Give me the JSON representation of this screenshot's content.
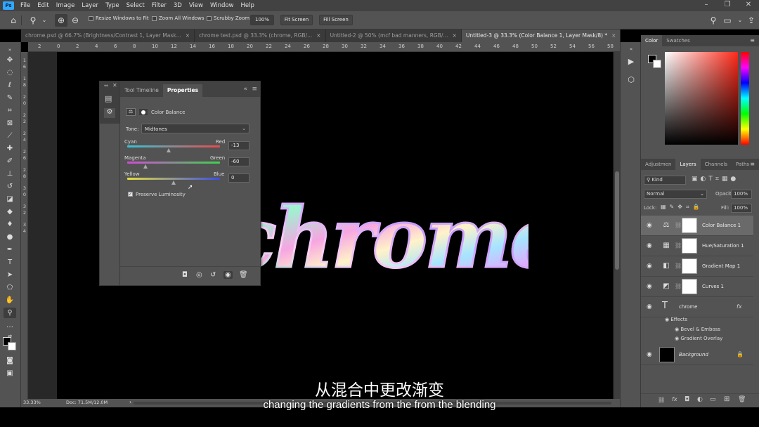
{
  "app": {
    "logo": "Ps"
  },
  "menu": [
    "File",
    "Edit",
    "Image",
    "Layer",
    "Type",
    "Select",
    "Filter",
    "3D",
    "View",
    "Window",
    "Help"
  ],
  "options": {
    "resize_windows": "Resize Windows to Fit",
    "zoom_all": "Zoom All Windows",
    "scrubby_zoom": "Scrubby Zoom",
    "zoom_value": "100%",
    "fit_screen": "Fit Screen",
    "fill_screen": "Fill Screen"
  },
  "tabs": [
    {
      "label": "chrome.psd @ 66.7% (Brightness/Contrast 1, Layer Mask...",
      "close": "×"
    },
    {
      "label": "chrome test.psd @ 33.3% (chrome, RGB/...",
      "close": "×"
    },
    {
      "label": "Untitled-2 @ 50% (mcf bad manners, RGB/...",
      "close": "×"
    },
    {
      "label": "Untitled-3 @ 33.3% (Color Balance 1, Layer Mask/8) *",
      "close": "×"
    }
  ],
  "ruler_top": [
    "2",
    "0",
    "2",
    "4",
    "6",
    "8",
    "10",
    "12",
    "14",
    "16",
    "18",
    "20",
    "22",
    "24",
    "26",
    "28",
    "30",
    "32",
    "34",
    "36",
    "38",
    "40",
    "42",
    "44",
    "46",
    "48",
    "50",
    "52",
    "54",
    "56",
    "58"
  ],
  "ruler_left": [
    "1",
    "6",
    "1",
    "8",
    "2",
    "0",
    "2",
    "2",
    "2",
    "4",
    "2",
    "6",
    "2",
    "8",
    "3",
    "0",
    "3",
    "2",
    "3",
    "4"
  ],
  "canvas_text": "chrome",
  "properties": {
    "tab_timeline": "Tool Timeline",
    "tab_properties": "Properties",
    "collapse": "«",
    "menu": "≡",
    "title": "Color Balance",
    "tone_label": "Tone:",
    "tone_value": "Midtones",
    "sliders": [
      {
        "left": "Cyan",
        "right": "Red",
        "value": "-13",
        "pos": 0.45
      },
      {
        "left": "Magenta",
        "right": "Green",
        "value": "-60",
        "pos": 0.2
      },
      {
        "left": "Yellow",
        "right": "Blue",
        "value": "0",
        "pos": 0.5
      }
    ],
    "preserve": "Preserve Luminosity"
  },
  "status": {
    "zoom": "33.33%",
    "doc": "Doc: 71.5M/12.0M",
    "arrow": "›"
  },
  "subtitles": {
    "zh": "从混合中更改渐变",
    "en": "changing the gradients from the from the blending"
  },
  "color_panel": {
    "tab_color": "Color",
    "tab_swatches": "Swatches"
  },
  "layers_panel": {
    "tabs": [
      "Adjustmen",
      "Layers",
      "Channels",
      "Paths"
    ],
    "kind": "Kind",
    "blend": "Normal",
    "opacity_label": "Opacity:",
    "opacity": "100%",
    "lock_label": "Lock:",
    "fill_label": "Fill:",
    "fill": "100%",
    "layers": [
      {
        "name": "Color Balance 1",
        "icon": "⚖"
      },
      {
        "name": "Hue/Saturation 1",
        "icon": "▦"
      },
      {
        "name": "Gradient Map 1",
        "icon": "◧"
      },
      {
        "name": "Curves 1",
        "icon": "◩"
      }
    ],
    "text_layer": "chrome",
    "fx": "fx",
    "effects": "Effects",
    "effect_items": [
      "Bevel & Emboss",
      "Gradient Overlay"
    ],
    "background": "Background"
  },
  "colors": {
    "accent": "#31a8ff",
    "panel": "#535353",
    "dark": "#424242"
  }
}
